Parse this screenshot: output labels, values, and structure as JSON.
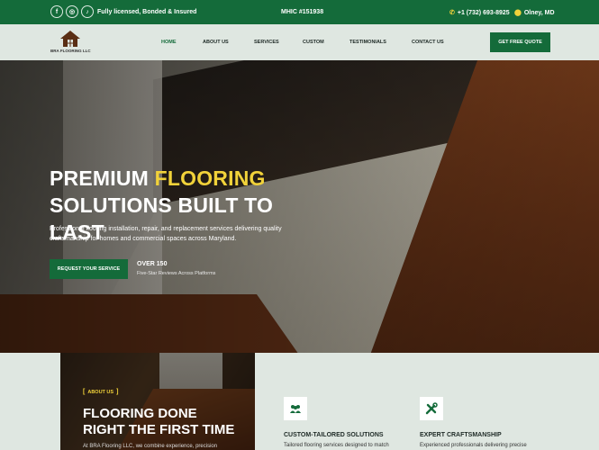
{
  "topbar": {
    "social": [
      {
        "icon": "facebook-icon",
        "glyph": "f"
      },
      {
        "icon": "instagram-icon",
        "glyph": "◎"
      },
      {
        "icon": "tiktok-icon",
        "glyph": "♪"
      }
    ],
    "licensed": "Fully licensed, Bonded & Insured",
    "mhic": "MHIC #151938",
    "phone": "+1 (732) 693-8925",
    "location": "Olney, MD"
  },
  "nav": {
    "logo_text": "BRA FLOORING LLC",
    "items": [
      "HOME",
      "ABOUT US",
      "SERVICES",
      "CUSTOM",
      "TESTIMONIALS",
      "CONTACT US"
    ],
    "cta": "GET FREE QUOTE"
  },
  "hero": {
    "title_line1_a": "PREMIUM ",
    "title_line1_b": "FLOORING",
    "title_line2": "SOLUTIONS BUILT TO LAST",
    "description": "Professional flooring installation, repair, and replacement services delivering quality craftsmanship for homes and commercial spaces across Maryland.",
    "cta": "REQUEST YOUR SERVICE",
    "reviews_title": "OVER 150",
    "reviews_sub": "Five-Star Reviews Across Platforms"
  },
  "about": {
    "tag": "ABOUT US",
    "title": "FLOORING DONE RIGHT THE FIRST TIME",
    "text": "At BRA Flooring LLC, we combine experience, precision"
  },
  "features": [
    {
      "icon": "people-icon",
      "title": "CUSTOM-TAILORED SOLUTIONS",
      "text": "Tailored flooring services designed to match"
    },
    {
      "icon": "tools-icon",
      "title": "EXPERT CRAFTSMANSHIP",
      "text": "Experienced professionals delivering precise"
    }
  ],
  "colors": {
    "brand_green": "#146b3a",
    "accent_yellow": "#f1d23a",
    "background": "#dfe7e1"
  }
}
